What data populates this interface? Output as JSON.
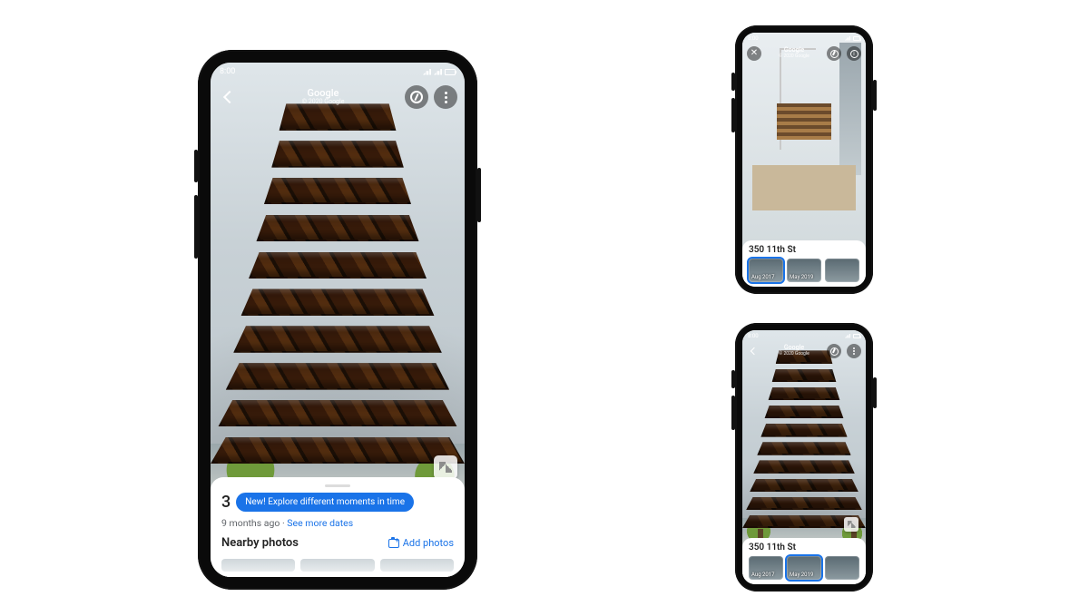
{
  "status": {
    "time": "8:00"
  },
  "header": {
    "title": "Google",
    "subtitle": "© 2020 Google"
  },
  "card_lg": {
    "address_prefix": "3",
    "tooltip": "New! Explore different moments in time",
    "meta_age": "9 months ago",
    "meta_sep": " · ",
    "meta_link": "See more dates",
    "nearby_label": "Nearby photos",
    "add_photos": "Add photos"
  },
  "card_sm": {
    "address": "350 11th St",
    "thumbs": [
      {
        "label": "Aug 2017"
      },
      {
        "label": "May 2019"
      },
      {
        "label": ""
      }
    ]
  },
  "icons": {
    "back": "back-arrow-icon",
    "close": "close-icon",
    "compass": "compass-icon",
    "more": "more-vert-icon",
    "info": "info-icon",
    "map": "map-icon",
    "camera": "camera-add-icon"
  }
}
